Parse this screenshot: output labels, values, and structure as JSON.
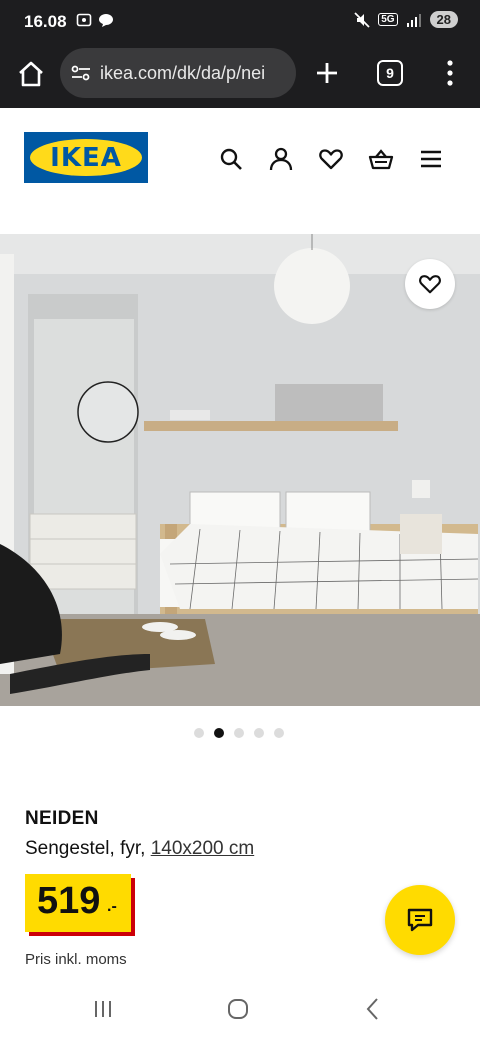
{
  "status_bar": {
    "time": "16.08",
    "network": "5G",
    "battery": "28",
    "icons": [
      "screenshot-icon",
      "chat-bubble-icon",
      "mute-icon",
      "signal-icon"
    ]
  },
  "browser": {
    "url": "ikea.com/dk/da/p/nei",
    "tab_count": "9",
    "icons": [
      "home-icon",
      "site-settings-icon",
      "plus-icon",
      "more-vertical-icon"
    ]
  },
  "header": {
    "logo_text": "IKEA",
    "icons": [
      "search-icon",
      "account-icon",
      "heart-icon",
      "basket-icon",
      "menu-icon"
    ]
  },
  "carousel": {
    "total": 5,
    "active_index": 1
  },
  "product": {
    "name": "NEIDEN",
    "description": "Sengestel, fyr,",
    "size": "140x200 cm",
    "price_value": "519",
    "price_suffix": ".-",
    "price_note": "Pris inkl. moms"
  },
  "colors": {
    "ikea_blue": "#0058a3",
    "ikea_yellow": "#ffda1a",
    "price_yellow": "#ffdb00",
    "price_red_shadow": "#cc0008",
    "chrome_dark": "#1d1d1f"
  },
  "nav_bar": {
    "icons": [
      "recent-apps-icon",
      "home-circle-icon",
      "back-icon"
    ]
  }
}
